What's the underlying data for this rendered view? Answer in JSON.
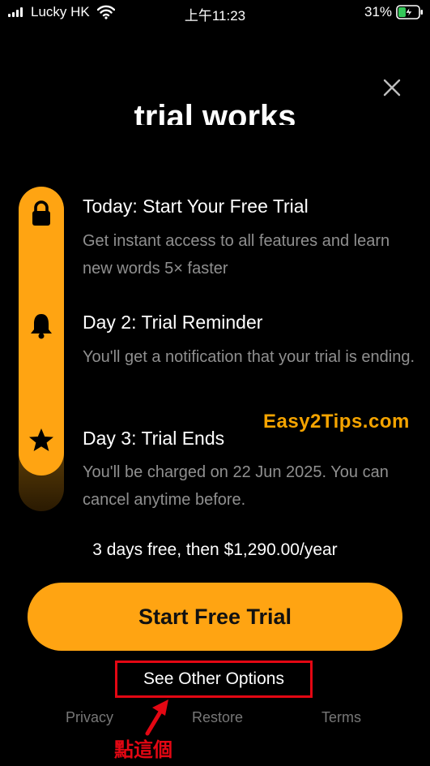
{
  "status_bar": {
    "carrier": "Lucky HK",
    "time": "上午11:23",
    "battery": "31%"
  },
  "close_icon": "close-icon",
  "header": {
    "title_fragment": "trial works"
  },
  "steps": [
    {
      "icon": "lock-icon",
      "title": "Today: Start Your Free Trial",
      "description": "Get instant access to all features and learn new words 5× faster"
    },
    {
      "icon": "bell-icon",
      "title": "Day 2: Trial Reminder",
      "description": "You'll get a notification that your trial is ending."
    },
    {
      "icon": "star-icon",
      "title": "Day 3: Trial Ends",
      "description": "You'll be charged on 22 Jun 2025. You can cancel anytime before."
    }
  ],
  "watermark": "Easy2Tips.com",
  "pricing": "3 days free, then $1,290.00/year",
  "cta": {
    "label": "Start Free Trial"
  },
  "other_options": "See Other Options",
  "footer": {
    "privacy": "Privacy",
    "restore": "Restore",
    "terms": "Terms"
  },
  "annotation": {
    "text": "點這個"
  },
  "colors": {
    "accent": "#FFA412",
    "annotation_red": "#E30713",
    "watermark": "#F5A400",
    "background": "#000000",
    "muted_text": "#8F8F8F"
  }
}
